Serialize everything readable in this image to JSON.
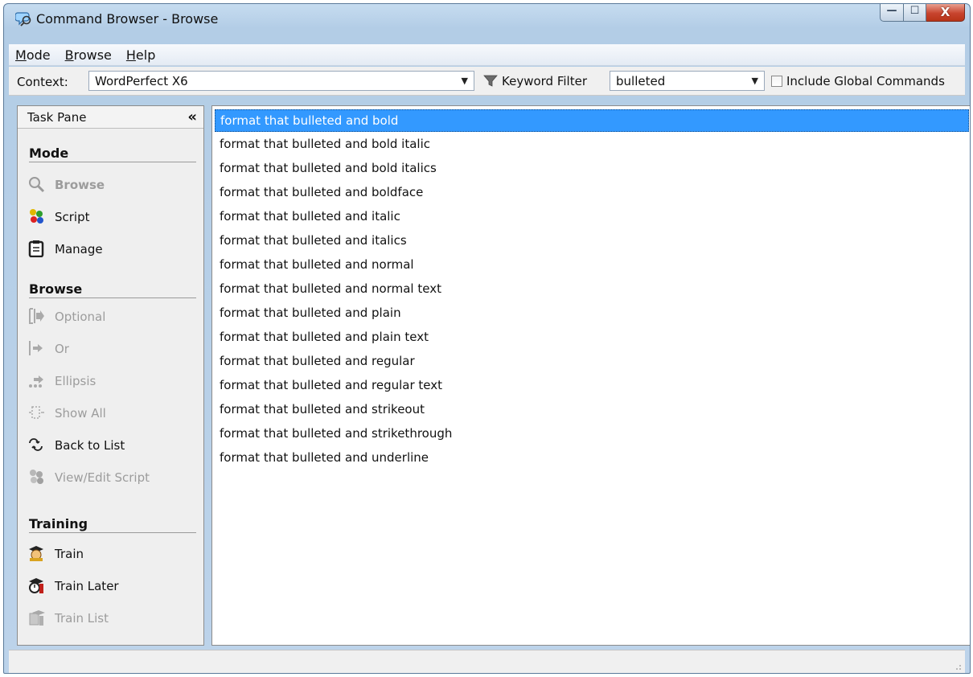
{
  "window": {
    "title": "Command Browser - Browse",
    "minimize_glyph": "—",
    "maximize_glyph": "☐",
    "close_glyph": "X"
  },
  "menu": {
    "items": [
      {
        "label": "Mode",
        "mnemonic": "M"
      },
      {
        "label": "Browse",
        "mnemonic": "B"
      },
      {
        "label": "Help",
        "mnemonic": "H"
      }
    ]
  },
  "toolbar": {
    "context_label": "Context:",
    "context_value": "WordPerfect X6",
    "keyword_filter_label": "Keyword Filter",
    "keyword_value": "bulleted",
    "include_global_label": "Include Global Commands",
    "include_global_checked": false
  },
  "task_pane": {
    "title": "Task Pane",
    "collapse_glyph": "«",
    "sections": [
      {
        "title": "Mode",
        "items": [
          {
            "label": "Browse",
            "icon": "magnifier-icon",
            "state": "active"
          },
          {
            "label": "Script",
            "icon": "script-icon",
            "state": "enabled"
          },
          {
            "label": "Manage",
            "icon": "clipboard-icon",
            "state": "enabled"
          }
        ]
      },
      {
        "title": "Browse",
        "items": [
          {
            "label": "Optional",
            "icon": "optional-icon",
            "state": "disabled"
          },
          {
            "label": "Or",
            "icon": "or-arrow-icon",
            "state": "disabled"
          },
          {
            "label": "Ellipsis",
            "icon": "ellipsis-icon",
            "state": "disabled"
          },
          {
            "label": "Show All",
            "icon": "show-all-icon",
            "state": "disabled"
          },
          {
            "label": "Back to List",
            "icon": "back-to-list-icon",
            "state": "enabled"
          },
          {
            "label": "View/Edit Script",
            "icon": "view-edit-script-icon",
            "state": "disabled"
          }
        ]
      },
      {
        "title": "Training",
        "items": [
          {
            "label": "Train",
            "icon": "train-icon",
            "state": "enabled"
          },
          {
            "label": "Train Later",
            "icon": "train-later-icon",
            "state": "enabled"
          },
          {
            "label": "Train List",
            "icon": "train-list-icon",
            "state": "disabled"
          }
        ]
      }
    ]
  },
  "commands": {
    "selected_index": 0,
    "items": [
      "format that bulleted and bold",
      "format that bulleted and bold italic",
      "format that bulleted and bold italics",
      "format that bulleted and boldface",
      "format that bulleted and italic",
      "format that bulleted and italics",
      "format that bulleted and normal",
      "format that bulleted and normal text",
      "format that bulleted and plain",
      "format that bulleted and plain text",
      "format that bulleted and regular",
      "format that bulleted and regular text",
      "format that bulleted and strikeout",
      "format that bulleted and strikethrough",
      "format that bulleted and underline"
    ]
  },
  "colors": {
    "selection": "#3399ff",
    "disabled_text": "#9c9c9c",
    "title_gradient_top": "#c6dcf0"
  }
}
